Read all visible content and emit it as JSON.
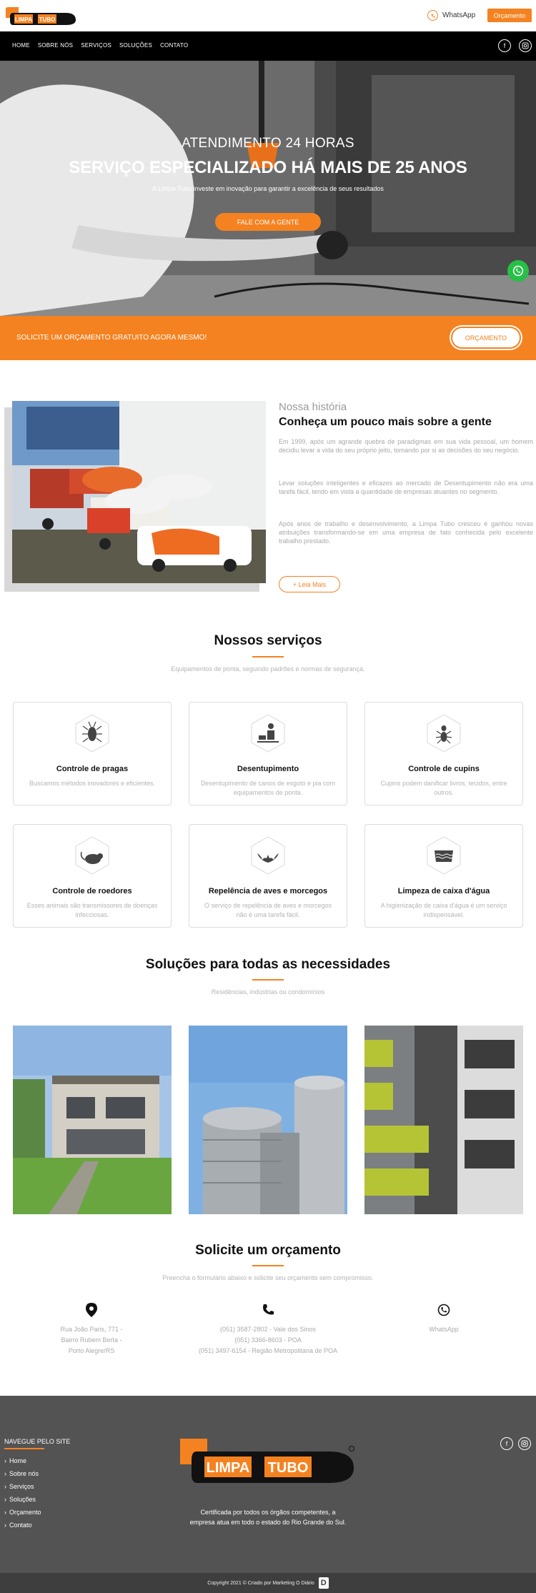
{
  "header": {
    "whatsapp_label": "WhatsApp",
    "budget_button": "Orçamento",
    "logo_words": [
      "LIMPA",
      "TUBO"
    ]
  },
  "nav": {
    "items": [
      "HOME",
      "SOBRE NÓS",
      "SERVIÇOS",
      "SOLUÇÕES",
      "CONTATO"
    ]
  },
  "hero": {
    "kicker": "ATENDIMENTO 24 HORAS",
    "title": "SERVIÇO ESPECIALIZADO HÁ MAIS DE 25 ANOS",
    "subtitle": "A Limpa Tubo investe em inovação para garantir a excelência de seus resultados",
    "cta": "FALE COM A GENTE"
  },
  "cta_band": {
    "text": "SOLICITE UM ORÇAMENTO GRATUITO AGORA MESMO!",
    "button": "ORÇAMENTO"
  },
  "about": {
    "kicker": "Nossa história",
    "title": "Conheça um pouco mais sobre a gente",
    "p1": "Em 1999, após um agrande quebra de paradigmas em sua vida pessoal, um homem decidiu levar a vida do seu próprio jeito, tomando por si as decisões do seu negócio.",
    "p2": "Levar soluções inteligentes e eficazes ao mercado de Desentupimento não era uma tarefa fácil, tendo em vista a quantidade de empresas atuantes no segmento.",
    "p3": "Após anos de trabalho e desenvolvimento, a Limpa Tubo cresceu é ganhou novas atribuições transformando-se em uma empresa de fato conhecida pelo excelente trabalho prestado.",
    "button": "+ Leia Mais"
  },
  "services": {
    "title": "Nossos serviços",
    "subtitle": "Equipamentos de ponta, seguindo padrões e normas de segurança.",
    "items": [
      {
        "title": "Controle de pragas",
        "text": "Buscamos métodos inovadores e eficientes.",
        "icon": "cockroach-icon"
      },
      {
        "title": "Desentupimento",
        "text": "Desentupimento de canos de esgoto e pia com equipamentos de ponta.",
        "icon": "plumber-icon"
      },
      {
        "title": "Controle de cupins",
        "text": "Cupins podem danificar livros, tecidos, entre outros.",
        "icon": "termite-icon"
      },
      {
        "title": "Controle de roedores",
        "text": "Esses animais são transmissores de doenças infecciosas.",
        "icon": "rat-icon"
      },
      {
        "title": "Repelência de aves e morcegos",
        "text": "O serviço de repelência de aves e morcegos não é uma tarefa fácil.",
        "icon": "bat-icon"
      },
      {
        "title": "Limpeza de caixa d'água",
        "text": "A higienização de caixa d'água é um serviço indispensável.",
        "icon": "water-tank-icon"
      }
    ]
  },
  "solutions": {
    "title": "Soluções para todas as necessidades",
    "subtitle": "Residências, indústrias ou condomínios"
  },
  "quote": {
    "title": "Solicite um orçamento",
    "subtitle": "Preencha o formulário abaixo e solicite seu orçamento sem compromisso.",
    "address": [
      "Rua João Paris, 771 -",
      "Bairro Rubem Berta -",
      "Porto Alegre/RS"
    ],
    "phones": [
      "(051) 3587-2802 - Vale dos Sinos",
      "(051) 3366-8603 - POA",
      "(051) 3497-6154 - Região Metropolitana de POA"
    ],
    "whatsapp": "WhatsApp"
  },
  "footer": {
    "nav_title": "NAVEGUE PELO SITE",
    "links": [
      "Home",
      "Sobre nós",
      "Serviços",
      "Soluções",
      "Orçamento",
      "Contato"
    ],
    "tagline_1": "Certificada por todos os órgãos competentes, a",
    "tagline_2": "empresa atua em todo o estado do Rio Grande do Sul.",
    "copyright": "Copyright 2021 © Criado por Marketing O Diário"
  },
  "colors": {
    "accent": "#f58220",
    "footer": "#535353",
    "nav": "#000000"
  }
}
